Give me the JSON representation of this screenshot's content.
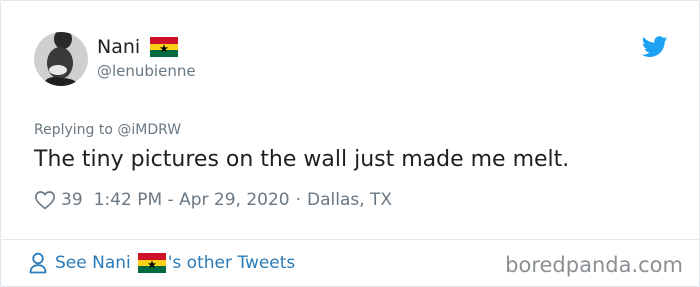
{
  "tweet": {
    "author_name": "Nani",
    "author_handle": "@lenubienne",
    "reply_prefix": "Replying to ",
    "reply_to": "@iMDRW",
    "text": "The tiny pictures on the wall just made me melt.",
    "likes": "39",
    "time": "1:42 PM - Apr 29, 2020",
    "separator": "·",
    "location": "Dallas, TX"
  },
  "footer": {
    "see_prefix": "See Nani",
    "see_suffix": "'s other Tweets"
  },
  "watermark": "boredpanda.com",
  "icons": {
    "author_flag": "ghana-flag-icon",
    "brand": "twitter-bird-icon",
    "like": "heart-icon",
    "profile": "person-icon"
  },
  "colors": {
    "text": "#1c2022",
    "muted": "#697882",
    "link": "#2b7bb9",
    "twitter_blue": "#1da1f2",
    "border": "#e1e8ed"
  }
}
